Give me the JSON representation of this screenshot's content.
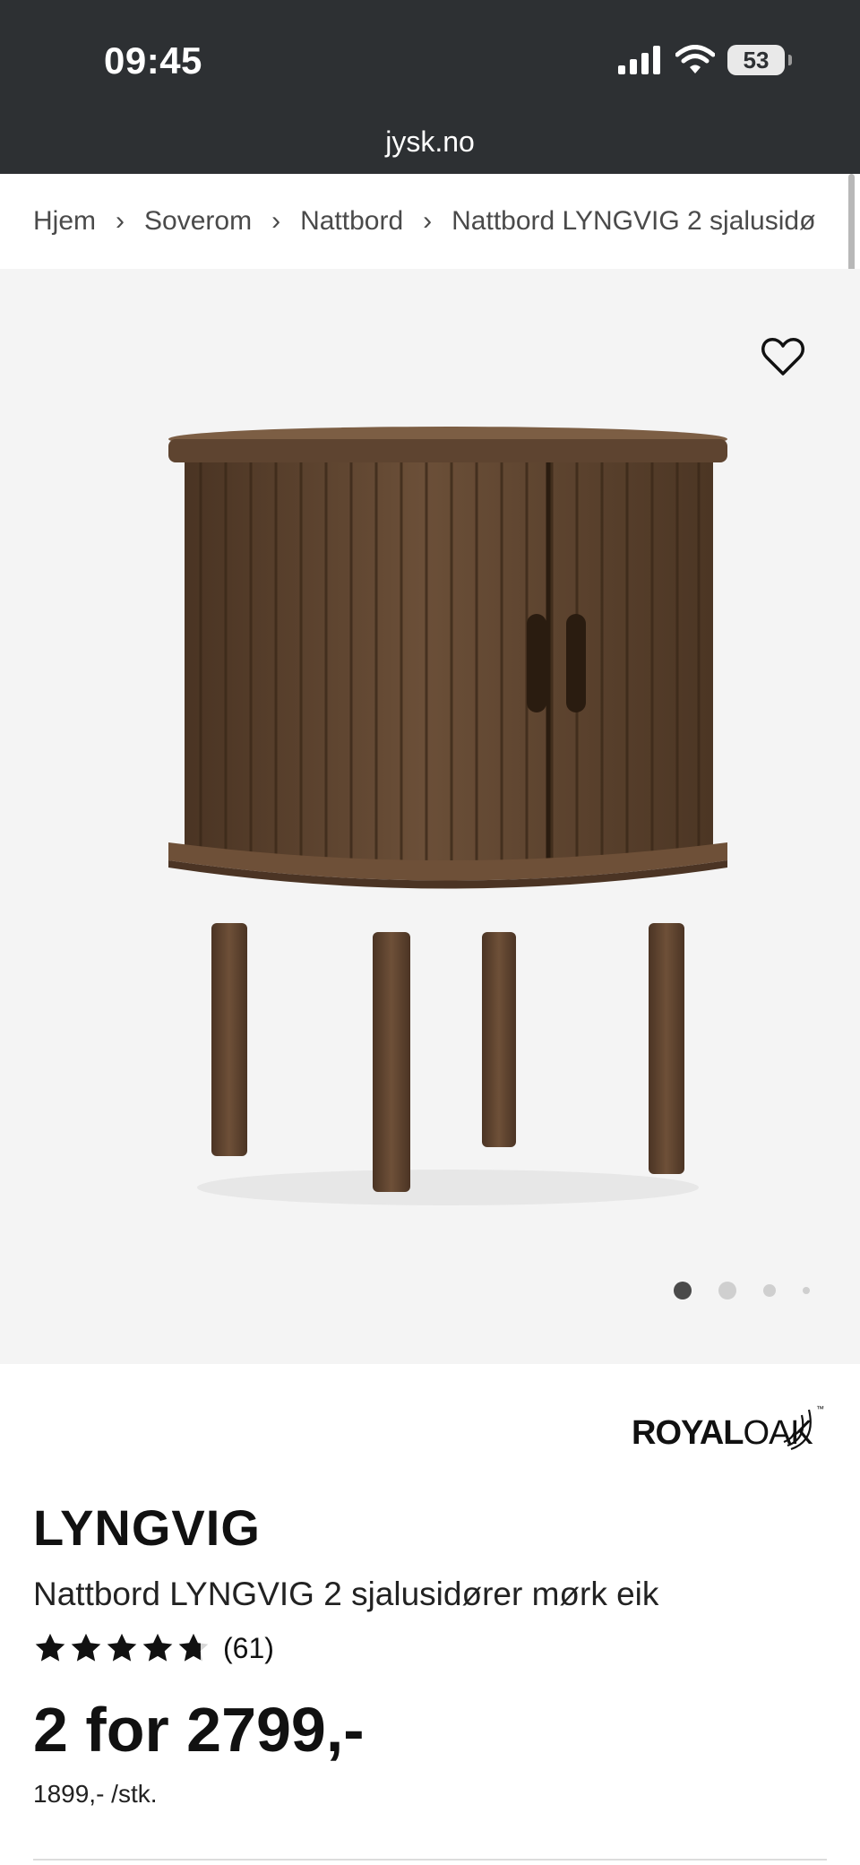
{
  "status_bar": {
    "time": "09:45",
    "battery": "53",
    "url": "jysk.no",
    "icons": [
      "signal-icon",
      "wifi-icon",
      "battery-icon"
    ]
  },
  "breadcrumb": {
    "items": [
      "Hjem",
      "Soverom",
      "Nattbord",
      "Nattbord LYNGVIG 2 sjalusidø"
    ]
  },
  "gallery": {
    "favorite_icon": "heart-icon",
    "image_count": 4,
    "active_index": 0
  },
  "brand": {
    "logo_text": "ROYALOAK",
    "logo_part1": "ROYAL",
    "logo_part2": "OAK",
    "logo_tm": "™"
  },
  "product": {
    "name": "LYNGVIG",
    "description": "Nattbord LYNGVIG 2 sjalusidører mørk eik",
    "rating": 4.7,
    "review_count": "(61)",
    "price": "2 for 2799,-",
    "unit_price": "1899,- /stk."
  },
  "colors": {
    "status_bar_bg": "#2d3033",
    "gallery_bg": "#f4f4f4",
    "wood_dark": "#5a412c",
    "wood_light": "#7c5e44",
    "text": "#111111"
  }
}
